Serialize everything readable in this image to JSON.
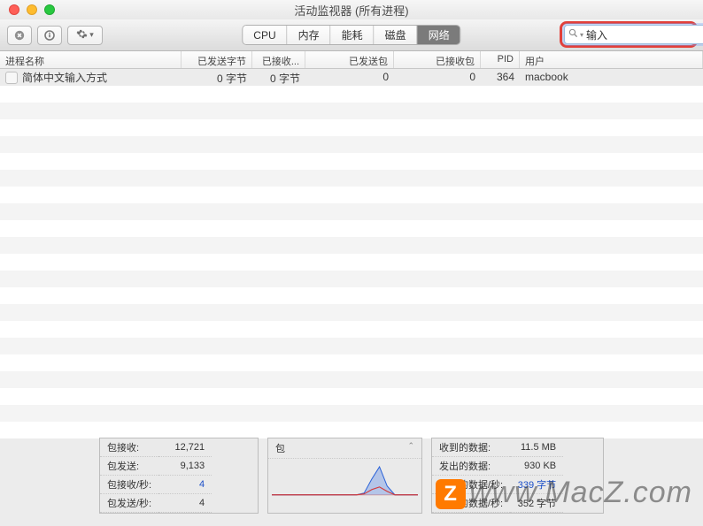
{
  "window": {
    "title": "活动监视器 (所有进程)"
  },
  "toolbar": {
    "tabs": [
      "CPU",
      "内存",
      "能耗",
      "磁盘",
      "网络"
    ],
    "active_tab_index": 4,
    "search_value": "输入"
  },
  "columns": {
    "name": "进程名称",
    "sent_bytes": "已发送字节",
    "recv_bytes": "已接收...",
    "sent_pkts": "已发送包",
    "recv_pkts": "已接收包",
    "pid": "PID",
    "user": "用户"
  },
  "rows": [
    {
      "name": "简体中文输入方式",
      "sent_bytes": "0 字节",
      "recv_bytes": "0 字节",
      "sent_pkts": "0",
      "recv_pkts": "0",
      "pid": "364",
      "user": "macbook"
    }
  ],
  "footer": {
    "left": [
      {
        "label": "包接收:",
        "value": "12,721"
      },
      {
        "label": "包发送:",
        "value": "9,133"
      },
      {
        "label": "包接收/秒:",
        "value": "4",
        "blue": true
      },
      {
        "label": "包发送/秒:",
        "value": "4"
      }
    ],
    "mid_label": "包",
    "right": [
      {
        "label": "收到的数据:",
        "value": "11.5 MB"
      },
      {
        "label": "发出的数据:",
        "value": "930 KB"
      },
      {
        "label": "收到的数据/秒:",
        "value": "339 字节",
        "blue": true
      },
      {
        "label": "发出的数据/秒:",
        "value": "352 字节"
      }
    ]
  },
  "watermark": "www.MacZ.com",
  "chart_data": {
    "type": "line",
    "title": "包",
    "series": [
      {
        "name": "recv",
        "color": "#2a62d8",
        "values": [
          0,
          0,
          0,
          0,
          0,
          0,
          0,
          0,
          0,
          0,
          0,
          0,
          2,
          18,
          32,
          10,
          0,
          0,
          0,
          0
        ]
      },
      {
        "name": "send",
        "color": "#d23b3b",
        "values": [
          0,
          0,
          0,
          0,
          0,
          0,
          0,
          0,
          0,
          0,
          0,
          0,
          1,
          6,
          9,
          4,
          0,
          0,
          0,
          0
        ]
      }
    ],
    "ylim": [
      0,
      35
    ]
  }
}
